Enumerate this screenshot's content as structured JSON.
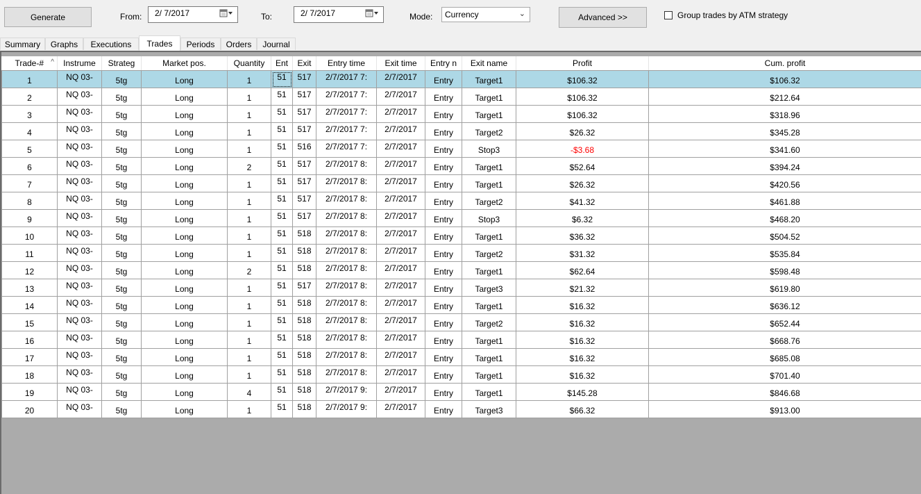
{
  "toolbar": {
    "generate_label": "Generate",
    "from_label": "From:",
    "from_value": "2/ 7/2017",
    "to_label": "To:",
    "to_value": "2/ 7/2017",
    "mode_label": "Mode:",
    "mode_value": "Currency",
    "advanced_label": "Advanced >>",
    "group_label": "Group trades by ATM strategy",
    "group_checked": false
  },
  "tabs": [
    "Summary",
    "Graphs",
    "Executions",
    "Trades",
    "Periods",
    "Orders",
    "Journal"
  ],
  "active_tab": "Trades",
  "columns": [
    "Trade-#",
    "Instrume",
    "Strateg",
    "Market pos.",
    "Quantity",
    "Ent",
    "Exit",
    "Entry time",
    "Exit time",
    "Entry n",
    "Exit name",
    "Profit",
    "Cum. profit"
  ],
  "sort_indicator": "^",
  "rows": [
    {
      "trade": "1",
      "instrument": "NQ 03-",
      "strategy": "5tg",
      "pos": "Long",
      "qty": "1",
      "entry": "51",
      "exit": "517",
      "entry_time": "2/7/2017 7:",
      "exit_time": "2/7/2017",
      "entry_name": "Entry",
      "exit_name": "Target1",
      "profit": "$106.32",
      "cum": "$106.32"
    },
    {
      "trade": "2",
      "instrument": "NQ 03-",
      "strategy": "5tg",
      "pos": "Long",
      "qty": "1",
      "entry": "51",
      "exit": "517",
      "entry_time": "2/7/2017 7:",
      "exit_time": "2/7/2017",
      "entry_name": "Entry",
      "exit_name": "Target1",
      "profit": "$106.32",
      "cum": "$212.64"
    },
    {
      "trade": "3",
      "instrument": "NQ 03-",
      "strategy": "5tg",
      "pos": "Long",
      "qty": "1",
      "entry": "51",
      "exit": "517",
      "entry_time": "2/7/2017 7:",
      "exit_time": "2/7/2017",
      "entry_name": "Entry",
      "exit_name": "Target1",
      "profit": "$106.32",
      "cum": "$318.96"
    },
    {
      "trade": "4",
      "instrument": "NQ 03-",
      "strategy": "5tg",
      "pos": "Long",
      "qty": "1",
      "entry": "51",
      "exit": "517",
      "entry_time": "2/7/2017 7:",
      "exit_time": "2/7/2017",
      "entry_name": "Entry",
      "exit_name": "Target2",
      "profit": "$26.32",
      "cum": "$345.28"
    },
    {
      "trade": "5",
      "instrument": "NQ 03-",
      "strategy": "5tg",
      "pos": "Long",
      "qty": "1",
      "entry": "51",
      "exit": "516",
      "entry_time": "2/7/2017 7:",
      "exit_time": "2/7/2017",
      "entry_name": "Entry",
      "exit_name": "Stop3",
      "profit": "-$3.68",
      "cum": "$341.60"
    },
    {
      "trade": "6",
      "instrument": "NQ 03-",
      "strategy": "5tg",
      "pos": "Long",
      "qty": "2",
      "entry": "51",
      "exit": "517",
      "entry_time": "2/7/2017 8:",
      "exit_time": "2/7/2017",
      "entry_name": "Entry",
      "exit_name": "Target1",
      "profit": "$52.64",
      "cum": "$394.24"
    },
    {
      "trade": "7",
      "instrument": "NQ 03-",
      "strategy": "5tg",
      "pos": "Long",
      "qty": "1",
      "entry": "51",
      "exit": "517",
      "entry_time": "2/7/2017 8:",
      "exit_time": "2/7/2017",
      "entry_name": "Entry",
      "exit_name": "Target1",
      "profit": "$26.32",
      "cum": "$420.56"
    },
    {
      "trade": "8",
      "instrument": "NQ 03-",
      "strategy": "5tg",
      "pos": "Long",
      "qty": "1",
      "entry": "51",
      "exit": "517",
      "entry_time": "2/7/2017 8:",
      "exit_time": "2/7/2017",
      "entry_name": "Entry",
      "exit_name": "Target2",
      "profit": "$41.32",
      "cum": "$461.88"
    },
    {
      "trade": "9",
      "instrument": "NQ 03-",
      "strategy": "5tg",
      "pos": "Long",
      "qty": "1",
      "entry": "51",
      "exit": "517",
      "entry_time": "2/7/2017 8:",
      "exit_time": "2/7/2017",
      "entry_name": "Entry",
      "exit_name": "Stop3",
      "profit": "$6.32",
      "cum": "$468.20"
    },
    {
      "trade": "10",
      "instrument": "NQ 03-",
      "strategy": "5tg",
      "pos": "Long",
      "qty": "1",
      "entry": "51",
      "exit": "518",
      "entry_time": "2/7/2017 8:",
      "exit_time": "2/7/2017",
      "entry_name": "Entry",
      "exit_name": "Target1",
      "profit": "$36.32",
      "cum": "$504.52"
    },
    {
      "trade": "11",
      "instrument": "NQ 03-",
      "strategy": "5tg",
      "pos": "Long",
      "qty": "1",
      "entry": "51",
      "exit": "518",
      "entry_time": "2/7/2017 8:",
      "exit_time": "2/7/2017",
      "entry_name": "Entry",
      "exit_name": "Target2",
      "profit": "$31.32",
      "cum": "$535.84"
    },
    {
      "trade": "12",
      "instrument": "NQ 03-",
      "strategy": "5tg",
      "pos": "Long",
      "qty": "2",
      "entry": "51",
      "exit": "518",
      "entry_time": "2/7/2017 8:",
      "exit_time": "2/7/2017",
      "entry_name": "Entry",
      "exit_name": "Target1",
      "profit": "$62.64",
      "cum": "$598.48"
    },
    {
      "trade": "13",
      "instrument": "NQ 03-",
      "strategy": "5tg",
      "pos": "Long",
      "qty": "1",
      "entry": "51",
      "exit": "517",
      "entry_time": "2/7/2017 8:",
      "exit_time": "2/7/2017",
      "entry_name": "Entry",
      "exit_name": "Target3",
      "profit": "$21.32",
      "cum": "$619.80"
    },
    {
      "trade": "14",
      "instrument": "NQ 03-",
      "strategy": "5tg",
      "pos": "Long",
      "qty": "1",
      "entry": "51",
      "exit": "518",
      "entry_time": "2/7/2017 8:",
      "exit_time": "2/7/2017",
      "entry_name": "Entry",
      "exit_name": "Target1",
      "profit": "$16.32",
      "cum": "$636.12"
    },
    {
      "trade": "15",
      "instrument": "NQ 03-",
      "strategy": "5tg",
      "pos": "Long",
      "qty": "1",
      "entry": "51",
      "exit": "518",
      "entry_time": "2/7/2017 8:",
      "exit_time": "2/7/2017",
      "entry_name": "Entry",
      "exit_name": "Target2",
      "profit": "$16.32",
      "cum": "$652.44"
    },
    {
      "trade": "16",
      "instrument": "NQ 03-",
      "strategy": "5tg",
      "pos": "Long",
      "qty": "1",
      "entry": "51",
      "exit": "518",
      "entry_time": "2/7/2017 8:",
      "exit_time": "2/7/2017",
      "entry_name": "Entry",
      "exit_name": "Target1",
      "profit": "$16.32",
      "cum": "$668.76"
    },
    {
      "trade": "17",
      "instrument": "NQ 03-",
      "strategy": "5tg",
      "pos": "Long",
      "qty": "1",
      "entry": "51",
      "exit": "518",
      "entry_time": "2/7/2017 8:",
      "exit_time": "2/7/2017",
      "entry_name": "Entry",
      "exit_name": "Target1",
      "profit": "$16.32",
      "cum": "$685.08"
    },
    {
      "trade": "18",
      "instrument": "NQ 03-",
      "strategy": "5tg",
      "pos": "Long",
      "qty": "1",
      "entry": "51",
      "exit": "518",
      "entry_time": "2/7/2017 8:",
      "exit_time": "2/7/2017",
      "entry_name": "Entry",
      "exit_name": "Target1",
      "profit": "$16.32",
      "cum": "$701.40"
    },
    {
      "trade": "19",
      "instrument": "NQ 03-",
      "strategy": "5tg",
      "pos": "Long",
      "qty": "4",
      "entry": "51",
      "exit": "518",
      "entry_time": "2/7/2017 9:",
      "exit_time": "2/7/2017",
      "entry_name": "Entry",
      "exit_name": "Target1",
      "profit": "$145.28",
      "cum": "$846.68"
    },
    {
      "trade": "20",
      "instrument": "NQ 03-",
      "strategy": "5tg",
      "pos": "Long",
      "qty": "1",
      "entry": "51",
      "exit": "518",
      "entry_time": "2/7/2017 9:",
      "exit_time": "2/7/2017",
      "entry_name": "Entry",
      "exit_name": "Target3",
      "profit": "$66.32",
      "cum": "$913.00"
    }
  ],
  "selected_row": 1,
  "colors": {
    "selected_row": "#add8e6",
    "negative": "#ff0000",
    "empty_area": "#ababab"
  }
}
